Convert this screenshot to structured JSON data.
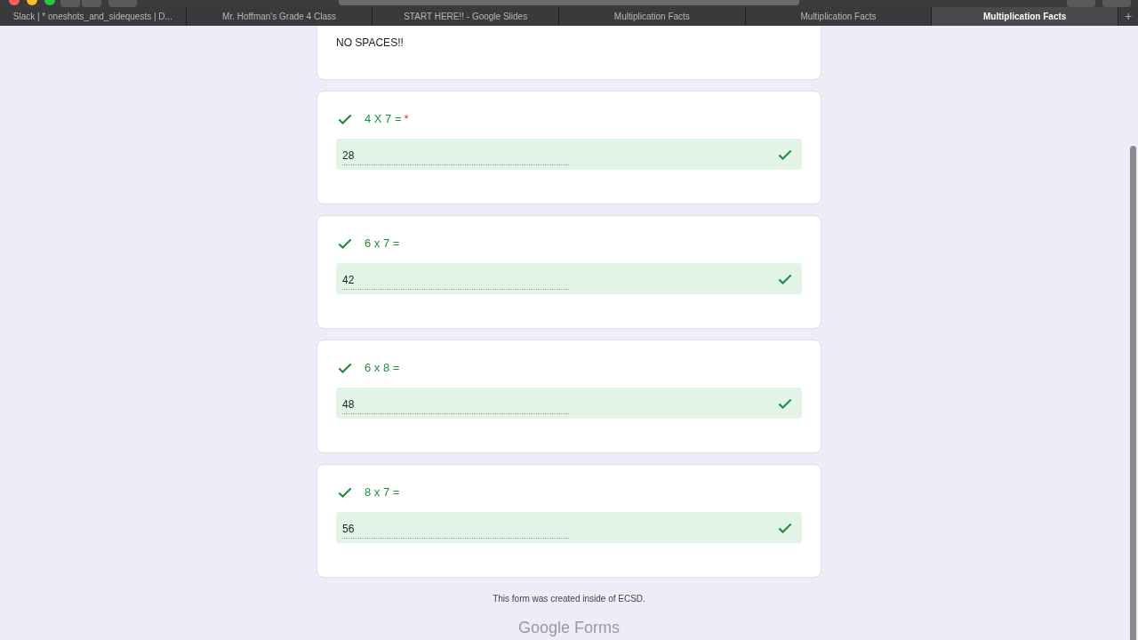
{
  "browser_tabs": [
    {
      "label": "Slack | * oneshots_and_sidequests | D...",
      "selected": false
    },
    {
      "label": "Mr. Hoffman's Grade 4 Class",
      "selected": false
    },
    {
      "label": "START HERE!! - Google Slides",
      "selected": false
    },
    {
      "label": "Multiplication Facts",
      "selected": false
    },
    {
      "label": "Multiplication Facts",
      "selected": false
    },
    {
      "label": "Multiplication Facts",
      "selected": true
    }
  ],
  "new_tab": "+",
  "required_mark": "*",
  "intro": {
    "text": "NO SPACES!!"
  },
  "questions": [
    {
      "title": "4 X 7 =",
      "required": true,
      "answer": "28",
      "correct": true
    },
    {
      "title": "6 x 7 =",
      "required": false,
      "answer": "42",
      "correct": true
    },
    {
      "title": "6 x 8 =",
      "required": false,
      "answer": "48",
      "correct": true
    },
    {
      "title": "8 x 7 =",
      "required": false,
      "answer": "56",
      "correct": true
    }
  ],
  "footer": {
    "note": "This form was created inside of ECSD.",
    "brand": "Google Forms"
  }
}
